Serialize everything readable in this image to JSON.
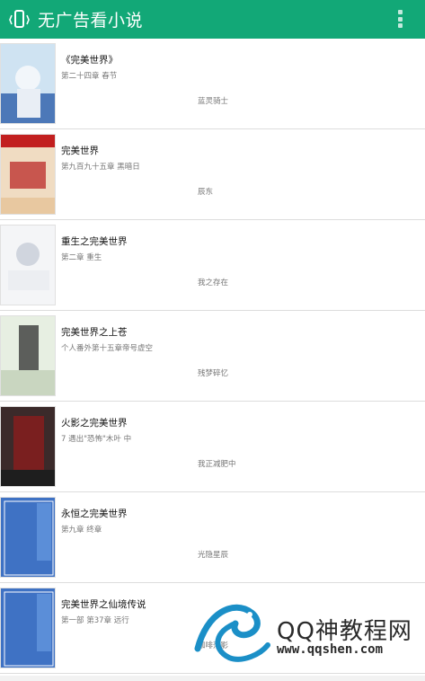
{
  "app": {
    "title": "无广告看小说",
    "icon": "phone-vibrate-icon",
    "menu_icon": "overflow-menu-icon",
    "bar_color": "#12a877"
  },
  "books": [
    {
      "title": "《完美世界》",
      "chapter": "第二十四章 春节",
      "author": "蓝灵骑士"
    },
    {
      "title": "完美世界",
      "chapter": "第九百九十五章 黑暗日",
      "author": "辰东"
    },
    {
      "title": "重生之完美世界",
      "chapter": "第二章 重生",
      "author": "我之存在"
    },
    {
      "title": "完美世界之上苍",
      "chapter": "个人番外第十五章帝号虚空",
      "author": "残梦碎忆"
    },
    {
      "title": "火影之完美世界",
      "chapter": "7 遇出\"恐怖\"木叶 中",
      "author": "我正减肥中"
    },
    {
      "title": "永恒之完美世界",
      "chapter": "第九章 终章",
      "author": "光隐星辰"
    },
    {
      "title": "完美世界之仙境传说",
      "chapter": "第一部 第37章 远行",
      "author": "咖啡落影"
    }
  ],
  "watermark": {
    "text": "QQ神教程网",
    "url": "www.qqshen.com"
  }
}
